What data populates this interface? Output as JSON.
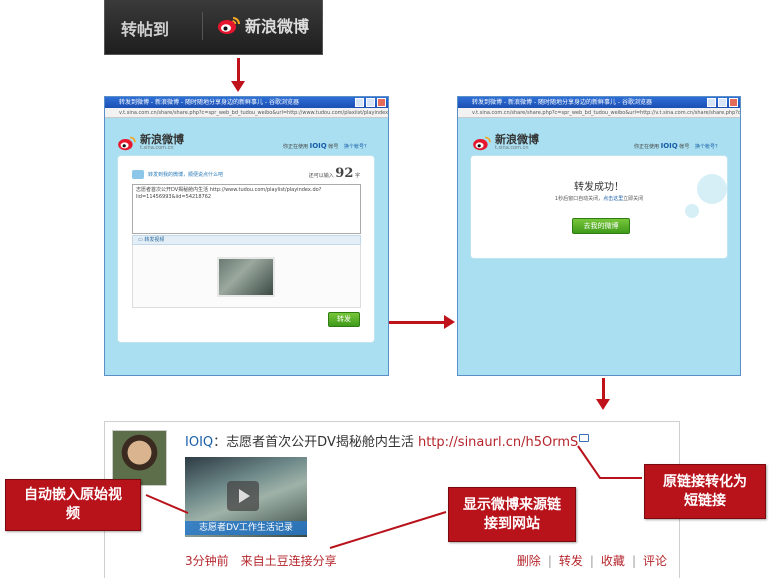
{
  "toolbar": {
    "share_label": "转帖到",
    "weibo_label": "新浪微博",
    "weibo_icon": "sina-weibo-logo-icon"
  },
  "window1": {
    "title": "转发到微博 - 新浪微博 - 随时随地分享身边的新鲜事儿 - 谷歌浏览器",
    "url": "v.t.sina.com.cn/share/share.php?c=spr_web_bd_tudou_weibo&url=http://www.tudou.com/plaxiist/playindex.do?l=",
    "logo_name": "新浪微博",
    "logo_domain": "t.sina.com.cn",
    "user_prefix": "你正在使用",
    "user_name": "IOIQ",
    "user_suffix": "帐号",
    "switch_account": "换个帐号？",
    "compose_prompt": "转发到我的微博，顺便说点什么吧",
    "remain_prefix": "还可以输入",
    "remain_count": "92",
    "remain_suffix": "字",
    "compose_text": "志愿者首次公开DV揭秘舱内生活 http://www.tudou.com/playlist/playindex.do?lid=11456993&iid=54218762",
    "video_strip_label": "转发视频",
    "submit_label": "转发"
  },
  "window2": {
    "title": "转发到微博 - 新浪微博 - 随时随地分享身边的新鲜事儿 - 谷歌浏览器",
    "url": "v.t.sina.com.cn/share/share.php?c=spr_web_bd_tudou_weibo&url=http://v.t.sina.com.cn/share/share.php?c",
    "logo_name": "新浪微博",
    "logo_domain": "t.sina.com.cn",
    "user_prefix": "你正在使用",
    "user_name": "IOIQ",
    "user_suffix": "帐号",
    "switch_account": "换个帐号？",
    "success_title": "转发成功！",
    "success_sub_prefix": "1秒后窗口自动关闭，",
    "success_sub_link": "点击这里",
    "success_sub_suffix": "立即关闭",
    "goto_label": "去我的微博"
  },
  "feed": {
    "author": "IOIQ",
    "colon": "：",
    "text": "志愿者首次公开DV揭秘舱内生活 ",
    "short_url": "http://sinaurl.cn/h5OrmS",
    "video_caption": "志愿者DV工作生活记录",
    "time": "3分钟前",
    "source": "来自土豆连接分享",
    "actions": [
      "删除",
      "转发",
      "收藏",
      "评论"
    ]
  },
  "callouts": {
    "embed_video": "自动嵌入原始视频",
    "show_source": "显示微博来源链接到网站",
    "short_link": "原链接转化为短链接"
  },
  "colors": {
    "accent_red": "#b8121b",
    "link_blue": "#1a5ea8",
    "panel_blue": "#a9dff0",
    "button_green": "#4fae22"
  }
}
